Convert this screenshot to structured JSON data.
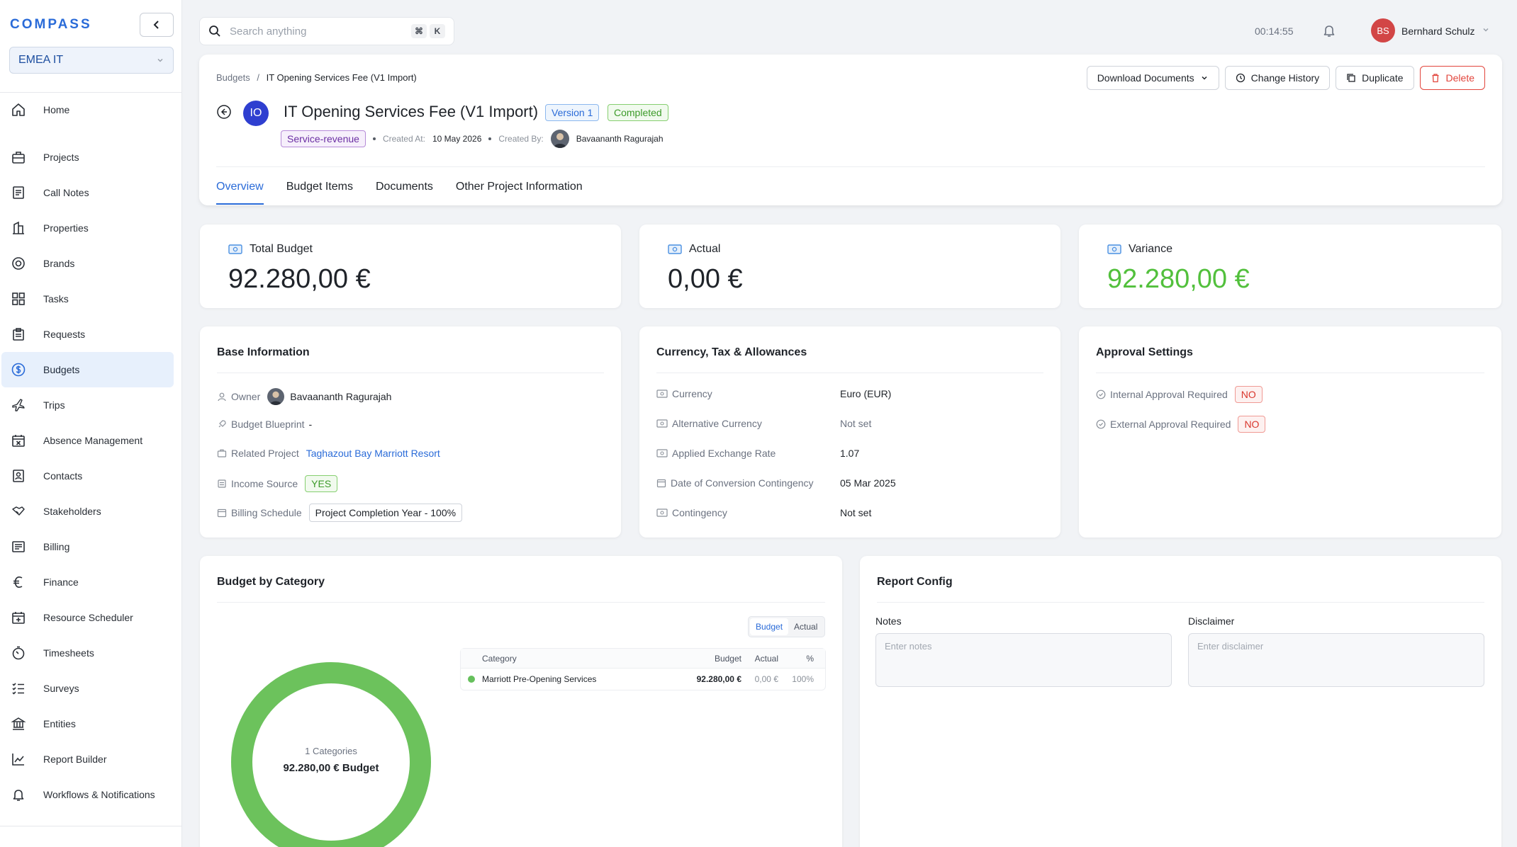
{
  "sidebar": {
    "logo": "COMPASS",
    "org": "EMEA IT",
    "items": [
      {
        "label": "Home"
      },
      {
        "label": "Projects"
      },
      {
        "label": "Call Notes"
      },
      {
        "label": "Properties"
      },
      {
        "label": "Brands"
      },
      {
        "label": "Tasks"
      },
      {
        "label": "Requests"
      },
      {
        "label": "Budgets"
      },
      {
        "label": "Trips"
      },
      {
        "label": "Absence Management"
      },
      {
        "label": "Contacts"
      },
      {
        "label": "Stakeholders"
      },
      {
        "label": "Billing"
      },
      {
        "label": "Finance"
      },
      {
        "label": "Resource Scheduler"
      },
      {
        "label": "Timesheets"
      },
      {
        "label": "Surveys"
      },
      {
        "label": "Entities"
      },
      {
        "label": "Report Builder"
      },
      {
        "label": "Workflows & Notifications"
      }
    ],
    "active_index": 7
  },
  "topbar": {
    "search_placeholder": "Search anything",
    "kbd_cmd": "⌘",
    "kbd_k": "K",
    "timer": "00:14:55",
    "user_initials": "BS",
    "user_name": "Bernhard Schulz"
  },
  "header": {
    "breadcrumb_parent": "Budgets",
    "breadcrumb_sep": "/",
    "breadcrumb_current": "IT Opening Services Fee (V1 Import)",
    "badge_initials": "IO",
    "title": "IT Opening Services Fee (V1 Import)",
    "version_tag": "Version 1",
    "status_tag": "Completed",
    "type_tag": "Service-revenue",
    "created_at_label": "Created At:",
    "created_at": "10 May 2026",
    "created_by_label": "Created By:",
    "created_by": "Bavaananth Ragurajah",
    "actions": {
      "download": "Download Documents",
      "history": "Change History",
      "duplicate": "Duplicate",
      "delete": "Delete"
    },
    "tabs": [
      "Overview",
      "Budget Items",
      "Documents",
      "Other Project Information"
    ]
  },
  "stats": {
    "total_label": "Total Budget",
    "total_value": "92.280,00 €",
    "actual_label": "Actual",
    "actual_value": "0,00 €",
    "variance_label": "Variance",
    "variance_value": "92.280,00 €",
    "variance_color": "#52c03c"
  },
  "base_info": {
    "title": "Base Information",
    "owner_label": "Owner",
    "owner": "Bavaananth Ragurajah",
    "blueprint_label": "Budget Blueprint",
    "blueprint": "-",
    "project_label": "Related Project",
    "project": "Taghazout Bay Marriott Resort",
    "income_label": "Income Source",
    "income": "YES",
    "billing_label": "Billing Schedule",
    "billing": "Project Completion Year - 100%"
  },
  "currency": {
    "title": "Currency, Tax & Allowances",
    "rows": [
      {
        "label": "Currency",
        "value": "Euro (EUR)"
      },
      {
        "label": "Alternative Currency",
        "value": "Not set"
      },
      {
        "label": "Applied Exchange Rate",
        "value": "1.07"
      },
      {
        "label": "Date of Conversion Contingency",
        "value": "05 Mar 2025"
      },
      {
        "label": "Contingency",
        "value": "Not set"
      }
    ]
  },
  "approval": {
    "title": "Approval Settings",
    "internal_label": "Internal Approval Required",
    "internal": "NO",
    "external_label": "External Approval Required",
    "external": "NO"
  },
  "budget_category": {
    "title": "Budget by Category",
    "toggle_budget": "Budget",
    "toggle_actual": "Actual",
    "col_category": "Category",
    "col_budget": "Budget",
    "col_actual": "Actual",
    "col_pct": "%",
    "row": {
      "category": "Marriott Pre-Opening Services",
      "budget": "92.280,00 €",
      "actual": "0,00 €",
      "pct": "100%"
    },
    "donut_sub": "1 Categories",
    "donut_main": "92.280,00 € Budget",
    "donut_fraction": 1.0,
    "donut_color": "#6cc25c"
  },
  "report": {
    "title": "Report Config",
    "notes_label": "Notes",
    "notes_placeholder": "Enter notes",
    "disclaimer_label": "Disclaimer",
    "disclaimer_placeholder": "Enter disclaimer"
  }
}
